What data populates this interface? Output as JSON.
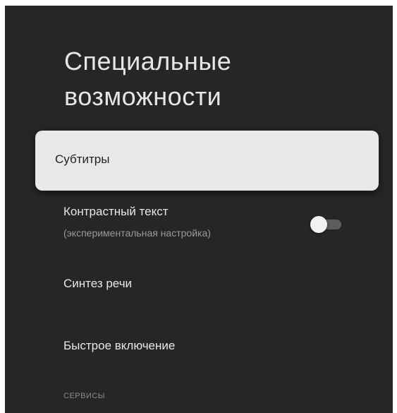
{
  "page": {
    "title_line1": "Специальные",
    "title_line2": "возможности"
  },
  "settings": {
    "items": [
      {
        "label": "Субтитры",
        "focused": true
      },
      {
        "label": "Контрастный текст",
        "sublabel": "(экспериментальная настройка)",
        "toggle_on": false
      },
      {
        "label": "Синтез речи"
      },
      {
        "label": "Быстрое включение"
      }
    ],
    "section_header": "СЕРВИСЫ"
  },
  "colors": {
    "background": "#262626",
    "focused_item": "#e8e8e8",
    "text_primary": "#e8e8e8",
    "text_secondary": "#9a9a9a"
  }
}
